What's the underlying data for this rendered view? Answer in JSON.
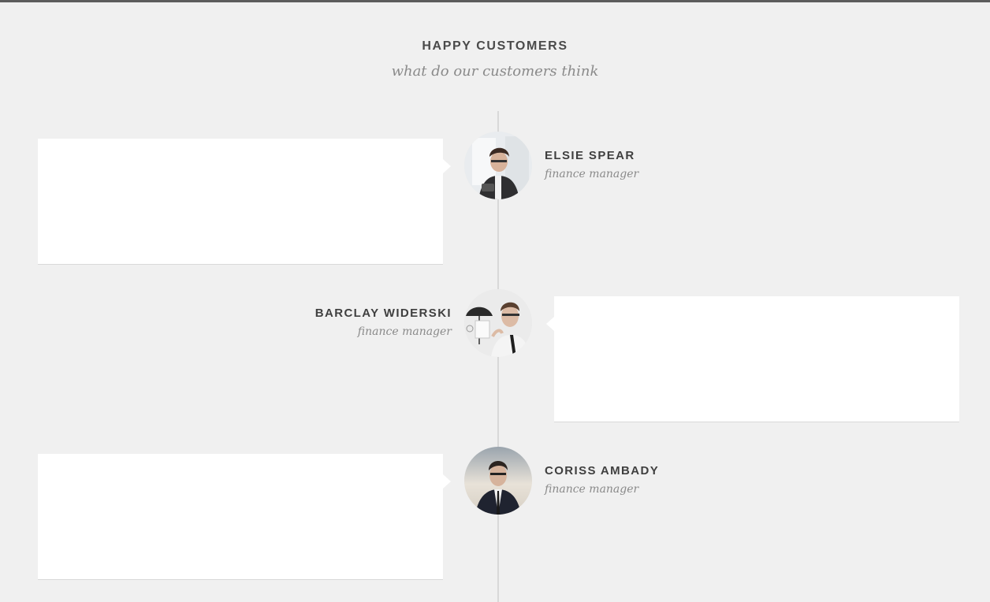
{
  "header": {
    "title": "HAPPY CUSTOMERS",
    "subtitle": "what do our customers think"
  },
  "testimonials": [
    {
      "name": "ELSIE SPEAR",
      "role": "finance manager",
      "avatar_icon": "person-photo-icon",
      "card_side": "left"
    },
    {
      "name": "BARCLAY WIDERSKI",
      "role": "finance manager",
      "avatar_icon": "person-with-umbrella-photo-icon",
      "card_side": "right"
    },
    {
      "name": "CORISS AMBADY",
      "role": "finance manager",
      "avatar_icon": "person-in-suit-photo-icon",
      "card_side": "left"
    }
  ],
  "colors": {
    "background": "#f0f0f0",
    "card": "#ffffff",
    "heading": "#4a4a4a",
    "muted": "#8a8a8a",
    "timeline": "#d8d8d8"
  }
}
